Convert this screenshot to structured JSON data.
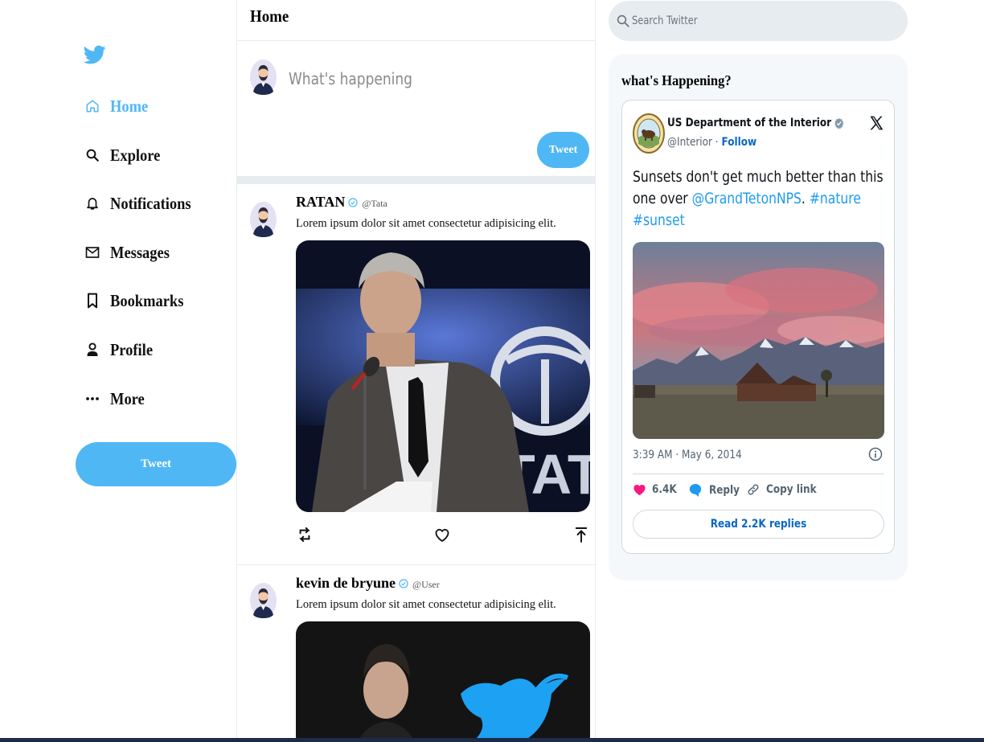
{
  "sidebar": {
    "logo": "twitter-bird-icon",
    "items": [
      {
        "label": "Home",
        "icon": "home-icon",
        "active": true
      },
      {
        "label": "Explore",
        "icon": "search-icon"
      },
      {
        "label": "Notifications",
        "icon": "bell-icon"
      },
      {
        "label": "Messages",
        "icon": "mail-icon"
      },
      {
        "label": "Bookmarks",
        "icon": "bookmark-icon"
      },
      {
        "label": "Profile",
        "icon": "person-icon"
      },
      {
        "label": "More",
        "icon": "more-icon"
      }
    ],
    "tweet_button": "Tweet"
  },
  "feed": {
    "title": "Home",
    "tweetbox": {
      "placeholder": "What's happening",
      "button": "Tweet"
    },
    "posts": [
      {
        "name": "RATAN",
        "handle": "@Tata",
        "text": "Lorem ipsum dolor sit amet consectetur adipisicing elit.",
        "verified": true
      },
      {
        "name": "kevin de bryune",
        "handle": "@User",
        "text": "Lorem ipsum dolor sit amet consectetur adipisicing elit.",
        "verified": true
      }
    ]
  },
  "search": {
    "placeholder": "Search Twitter"
  },
  "widget": {
    "title": "what's Happening?",
    "embed": {
      "account_name": "US Department of the Interior",
      "handle": "@Interior",
      "separator": "·",
      "follow": "Follow",
      "text_parts": [
        "Sunsets don't get much better than this one over ",
        "@GrandTetonNPS",
        ". ",
        "#nature",
        " ",
        "#sunset"
      ],
      "timestamp": "3:39 AM · May 6, 2014",
      "likes": "6.4K",
      "reply": "Reply",
      "copy_link": "Copy link",
      "read_replies": "Read 2.2K replies"
    }
  },
  "colors": {
    "accent": "#50b7f5",
    "link": "#1d9bf0",
    "follow": "#0a66c2",
    "like": "#f91880",
    "panel": "#f5f8fa",
    "border": "#e6ecf0"
  }
}
